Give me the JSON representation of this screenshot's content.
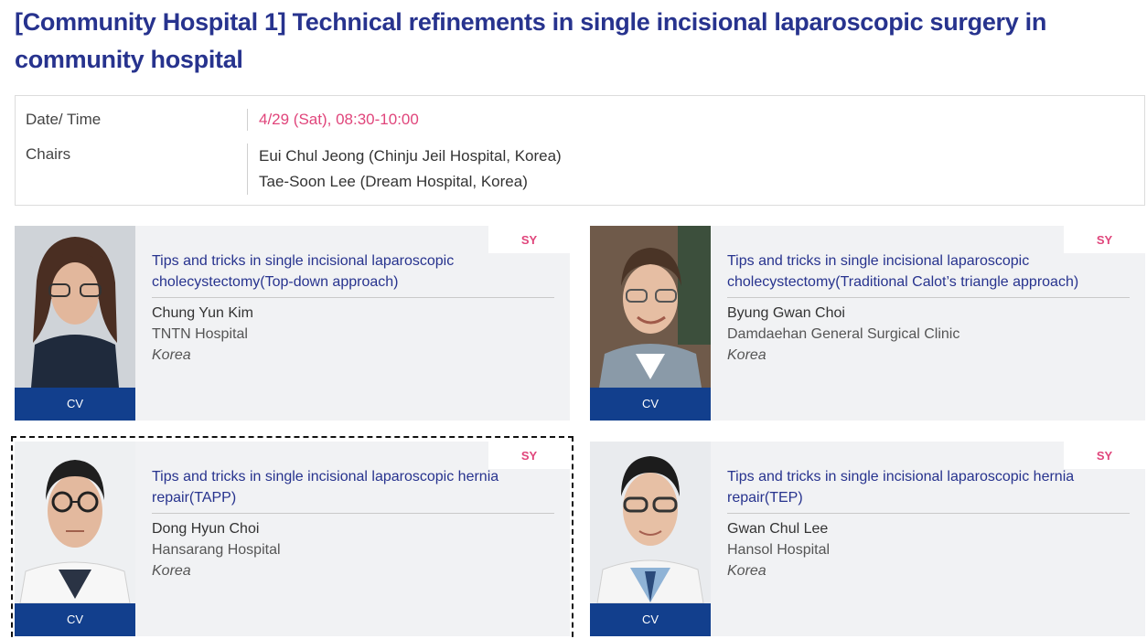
{
  "session": {
    "title": "[Community Hospital 1] Technical refinements in single incisional laparoscopic surgery in community hospital",
    "date_label": "Date/ Time",
    "date_value": "4/29 (Sat), 08:30-10:00",
    "chairs_label": "Chairs",
    "chairs": [
      "Eui Chul Jeong (Chinju Jeil Hospital, Korea)",
      "Tae-Soon Lee (Dream Hospital, Korea)"
    ]
  },
  "talks": [
    {
      "badge": "SY",
      "title": "Tips and tricks in single incisional laparoscopic cholecystectomy(Top-down approach)",
      "speaker": "Chung Yun Kim",
      "affiliation": "TNTN Hospital",
      "country": "Korea",
      "cv_label": "CV"
    },
    {
      "badge": "SY",
      "title": "Tips and tricks in single incisional laparoscopic cholecystectomy(Traditional Calot’s triangle approach)",
      "speaker": "Byung Gwan Choi",
      "affiliation": "Damdaehan General Surgical Clinic",
      "country": "Korea",
      "cv_label": "CV"
    },
    {
      "badge": "SY",
      "title": "Tips and tricks in single incisional laparoscopic hernia repair(TAPP)",
      "speaker": "Dong Hyun Choi",
      "affiliation": "Hansarang Hospital",
      "country": "Korea",
      "cv_label": "CV"
    },
    {
      "badge": "SY",
      "title": "Tips and tricks in single incisional laparoscopic hernia repair(TEP)",
      "speaker": "Gwan Chul Lee",
      "affiliation": "Hansol Hospital",
      "country": "Korea",
      "cv_label": "CV"
    }
  ],
  "colors": {
    "title": "#27338e",
    "accent_pink": "#e0457b",
    "cv_button": "#123f8d",
    "card_bg": "#f1f2f4"
  }
}
